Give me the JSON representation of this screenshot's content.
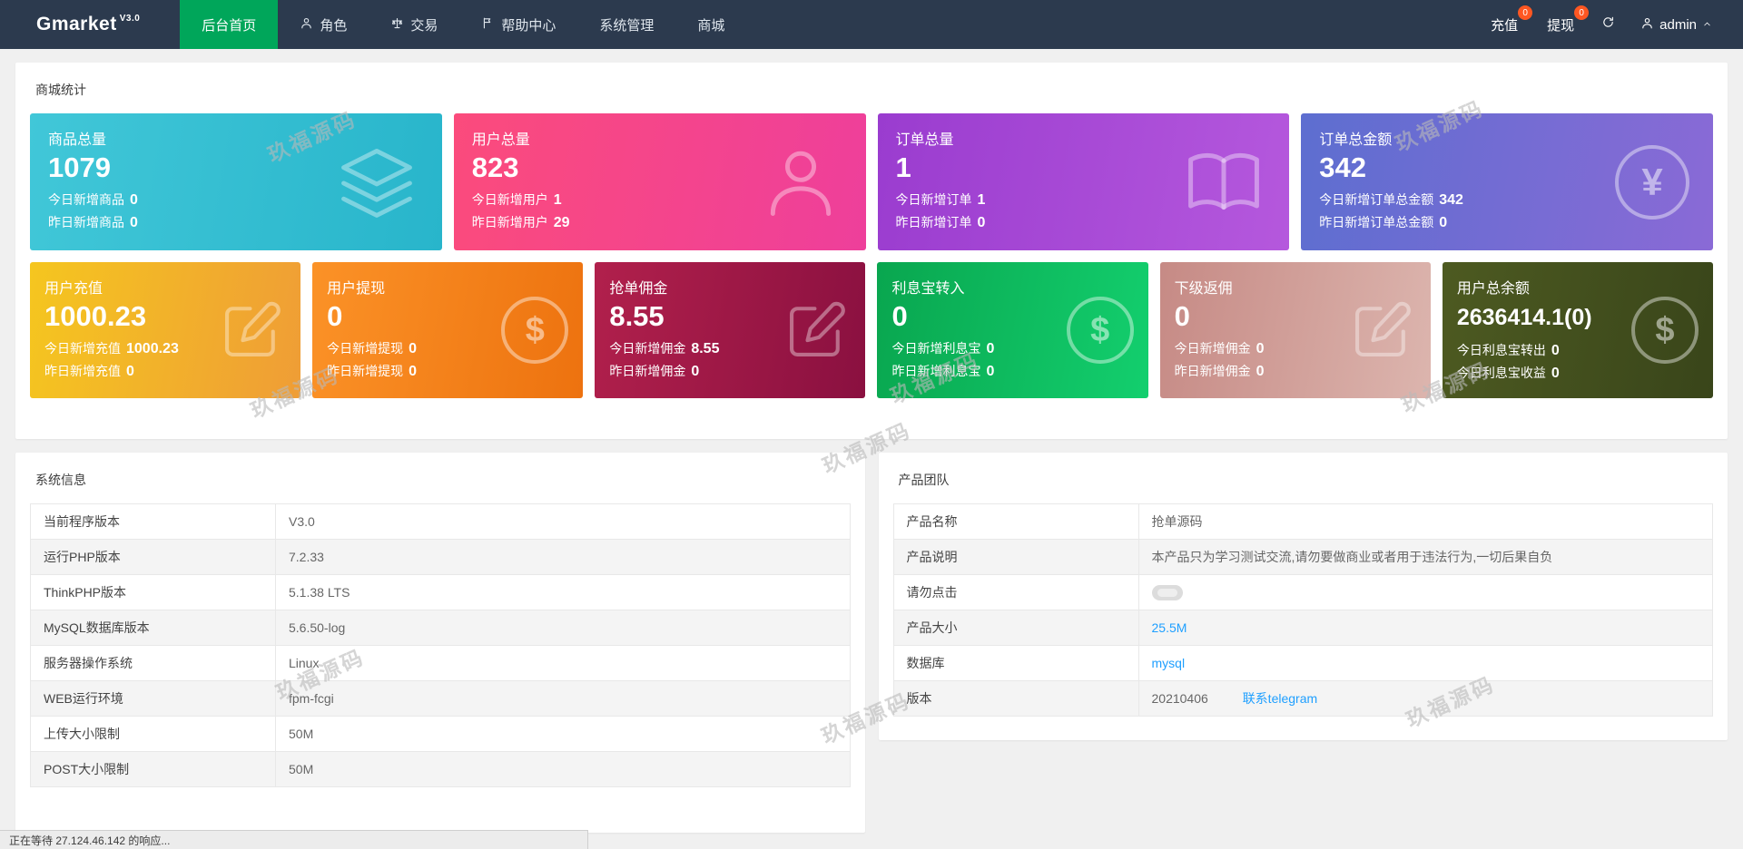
{
  "topbar": {
    "logo": "Gmarket",
    "version": "V3.0",
    "nav_items": [
      {
        "label": "后台首页",
        "icon": "none"
      },
      {
        "label": "角色",
        "icon": "person-icon"
      },
      {
        "label": "交易",
        "icon": "scale-icon"
      },
      {
        "label": "帮助中心",
        "icon": "flag-icon"
      },
      {
        "label": "系统管理",
        "icon": "none"
      },
      {
        "label": "商城",
        "icon": "none"
      }
    ],
    "recharge_label": "充值",
    "recharge_badge": "0",
    "withdraw_label": "提现",
    "withdraw_badge": "0",
    "username": "admin"
  },
  "colors": {
    "topbar_bg": "#2c3a4e",
    "active_nav": "#00a65a",
    "badge": "#ff5722",
    "link": "#1e9fff"
  },
  "stats": {
    "title": "商城统计",
    "cards": [
      {
        "title": "商品总量",
        "value": "1079",
        "line1_label": "今日新增商品",
        "line1_value": "0",
        "line2_label": "昨日新增商品",
        "line2_value": "0",
        "icon": "layers",
        "gradient": [
          "#41c7d8",
          "#28b5cb"
        ]
      },
      {
        "title": "用户总量",
        "value": "823",
        "line1_label": "今日新增用户",
        "line1_value": "1",
        "line2_label": "昨日新增用户",
        "line2_value": "29",
        "icon": "person",
        "gradient": [
          "#fb4b7c",
          "#ee3f9b"
        ]
      },
      {
        "title": "订单总量",
        "value": "1",
        "line1_label": "今日新增订单",
        "line1_value": "1",
        "line2_label": "昨日新增订单",
        "line2_value": "0",
        "icon": "book",
        "gradient": [
          "#9a3ccf",
          "#b558dd"
        ]
      },
      {
        "title": "订单总金额",
        "value": "342",
        "line1_label": "今日新增订单总金额",
        "line1_value": "342",
        "line2_label": "昨日新增订单总金额",
        "line2_value": "0",
        "icon": "yen-circle",
        "icon_glyph": "¥",
        "gradient": [
          "#5d6ed0",
          "#8a6ad6"
        ]
      },
      {
        "title": "用户充值",
        "value": "1000.23",
        "line1_label": "今日新增充值",
        "line1_value": "1000.23",
        "line2_label": "昨日新增充值",
        "line2_value": "0",
        "icon": "edit",
        "gradient": [
          "#f5c61f",
          "#ef9d36"
        ]
      },
      {
        "title": "用户提现",
        "value": "0",
        "line1_label": "今日新增提现",
        "line1_value": "0",
        "line2_label": "昨日新增提现",
        "line2_value": "0",
        "icon": "dollar-circle",
        "icon_glyph": "$",
        "gradient": [
          "#fb9227",
          "#ed720f"
        ]
      },
      {
        "title": "抢单佣金",
        "value": "8.55",
        "line1_label": "今日新增佣金",
        "line1_value": "8.55",
        "line2_label": "昨日新增佣金",
        "line2_value": "0",
        "icon": "edit",
        "gradient": [
          "#b1204c",
          "#8a1040"
        ]
      },
      {
        "title": "利息宝转入",
        "value": "0",
        "line1_label": "今日新增利息宝",
        "line1_value": "0",
        "line2_label": "昨日新增利息宝",
        "line2_value": "0",
        "icon": "dollar-circle",
        "icon_glyph": "$",
        "gradient": [
          "#09a64f",
          "#13cf6e"
        ]
      },
      {
        "title": "下级返佣",
        "value": "0",
        "line1_label": "今日新增佣金",
        "line1_value": "0",
        "line2_label": "昨日新增佣金",
        "line2_value": "0",
        "icon": "edit",
        "gradient": [
          "#c68a85",
          "#dcb5ae"
        ]
      },
      {
        "title": "用户总余额",
        "value": "2636414.1(0)",
        "line1_label": "今日利息宝转出",
        "line1_value": "0",
        "line2_label": "今日利息宝收益",
        "line2_value": "0",
        "icon": "dollar-circle",
        "icon_glyph": "$",
        "gradient": [
          "#4d5a21",
          "#39451a"
        ]
      }
    ]
  },
  "system_info": {
    "title": "系统信息",
    "rows": [
      {
        "label": "当前程序版本",
        "value": "V3.0"
      },
      {
        "label": "运行PHP版本",
        "value": "7.2.33"
      },
      {
        "label": "ThinkPHP版本",
        "value": "5.1.38 LTS"
      },
      {
        "label": "MySQL数据库版本",
        "value": "5.6.50-log"
      },
      {
        "label": "服务器操作系统",
        "value": "Linux"
      },
      {
        "label": "WEB运行环境",
        "value": "fpm-fcgi"
      },
      {
        "label": "上传大小限制",
        "value": "50M"
      },
      {
        "label": "POST大小限制",
        "value": "50M"
      }
    ]
  },
  "product_team": {
    "title": "产品团队",
    "rows": [
      {
        "label": "产品名称",
        "value": "抢单源码"
      },
      {
        "label": "产品说明",
        "value": "本产品只为学习测试交流,请勿要做商业或者用于违法行为,一切后果自负"
      },
      {
        "label": "请勿点击",
        "value": ""
      },
      {
        "label": "产品大小",
        "value": "25.5M"
      },
      {
        "label": "数据库",
        "value": "mysql"
      },
      {
        "label": "版本",
        "value": "20210406",
        "link": "联系telegram"
      }
    ]
  },
  "statusbar": {
    "text": "正在等待 27.124.46.142 的响应..."
  },
  "watermark": {
    "text": "玖福源码"
  }
}
